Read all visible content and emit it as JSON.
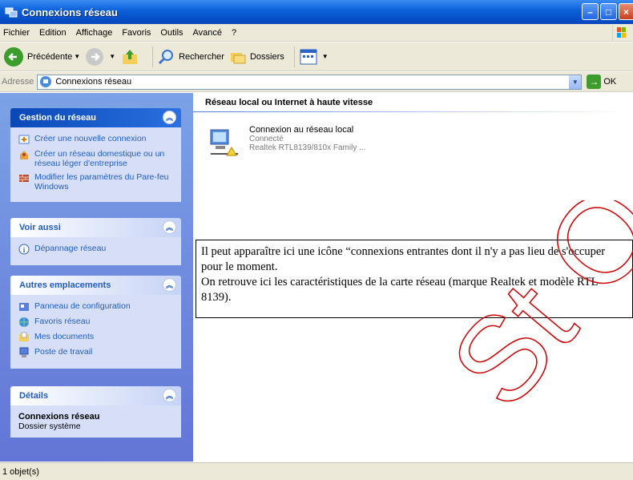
{
  "window": {
    "title": "Connexions réseau"
  },
  "menu": [
    "Fichier",
    "Edition",
    "Affichage",
    "Favoris",
    "Outils",
    "Avancé",
    "?"
  ],
  "toolbar": {
    "back": "Précédente",
    "search": "Rechercher",
    "folders": "Dossiers"
  },
  "address": {
    "label": "Adresse",
    "value": "Connexions réseau",
    "go": "OK"
  },
  "sidebar": {
    "gestion": {
      "title": "Gestion du réseau",
      "items": [
        {
          "label": "Créer une nouvelle connexion",
          "icon": "new-connection-icon"
        },
        {
          "label": "Créer un réseau domestique ou un réseau léger d'entreprise",
          "icon": "home-network-icon"
        },
        {
          "label": "Modifier les paramètres du Pare-feu Windows",
          "icon": "firewall-icon"
        }
      ]
    },
    "voir": {
      "title": "Voir aussi",
      "items": [
        {
          "label": "Dépannage réseau",
          "icon": "info-icon"
        }
      ]
    },
    "autres": {
      "title": "Autres emplacements",
      "items": [
        {
          "label": "Panneau de configuration",
          "icon": "control-panel-icon"
        },
        {
          "label": "Favoris réseau",
          "icon": "network-places-icon"
        },
        {
          "label": "Mes documents",
          "icon": "my-documents-icon"
        },
        {
          "label": "Poste de travail",
          "icon": "my-computer-icon"
        }
      ]
    },
    "details": {
      "title": "Détails",
      "name": "Connexions réseau",
      "type": "Dossier système"
    }
  },
  "content": {
    "group_title": "Réseau local ou Internet à haute vitesse",
    "connection": {
      "name": "Connexion au réseau local",
      "status": "Connecté",
      "adapter": "Realtek RTL8139/810x Family ..."
    }
  },
  "annotation": {
    "line1": "Il peut apparaître ici une icône “connexions entrantes dont il n'y a pas lieu de s'occuper pour le moment.",
    "line2": "On retrouve ici les caractéristiques de la carte réseau (marque Realtek et modèle RTL 8139)."
  },
  "status": {
    "text": "1 objet(s)"
  },
  "watermark": {
    "text": "St OM",
    "color": "#cc0000"
  },
  "colors": {
    "titlebar": "#0a5fd8",
    "sidepane": "#7ba2e7",
    "link": "#215dc6"
  }
}
